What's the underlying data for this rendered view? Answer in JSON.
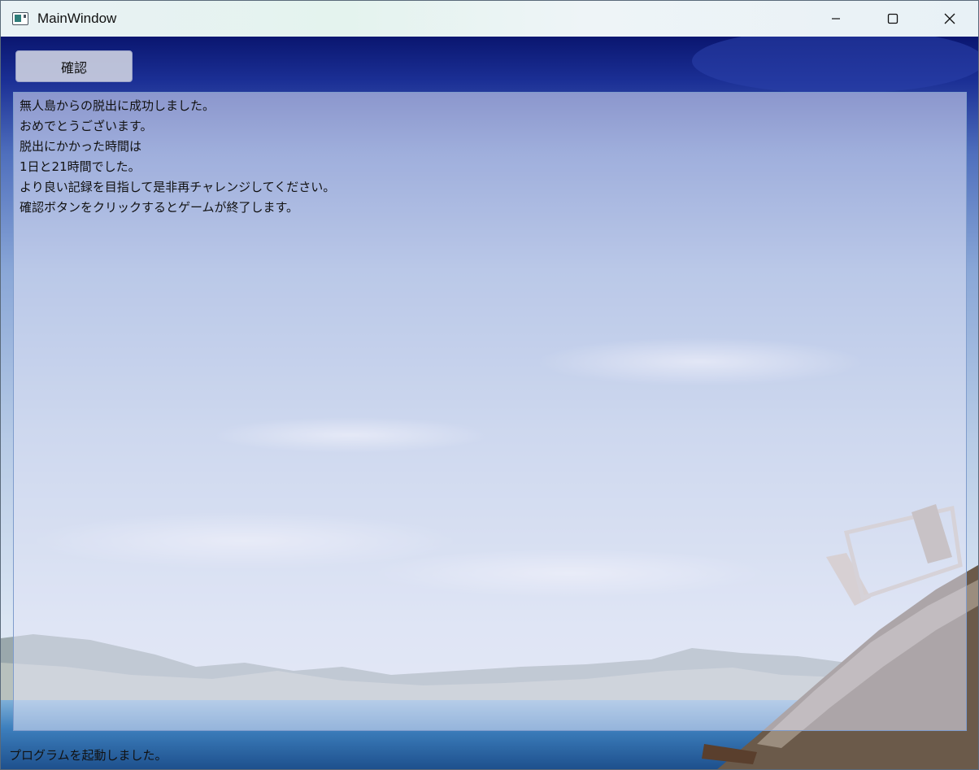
{
  "window": {
    "title": "MainWindow",
    "controls": {
      "minimize": "minimize-icon",
      "maximize": "maximize-icon",
      "close": "close-icon"
    }
  },
  "toolbar": {
    "confirm_label": "確認"
  },
  "message": {
    "lines": [
      "無人島からの脱出に成功しました。",
      "おめでとうございます。",
      "脱出にかかった時間は",
      "1日と21時間でした。",
      "より良い記録を目指して是非再チャレンジしてください。",
      "確認ボタンをクリックするとゲームが終了します。"
    ]
  },
  "status": {
    "text": "プログラムを起動しました。"
  },
  "colors": {
    "sky_top": "#0a1670",
    "sky_mid": "#bfd2ec",
    "sea": "#2e6ea8",
    "panel_border": "#7f9ccc"
  }
}
